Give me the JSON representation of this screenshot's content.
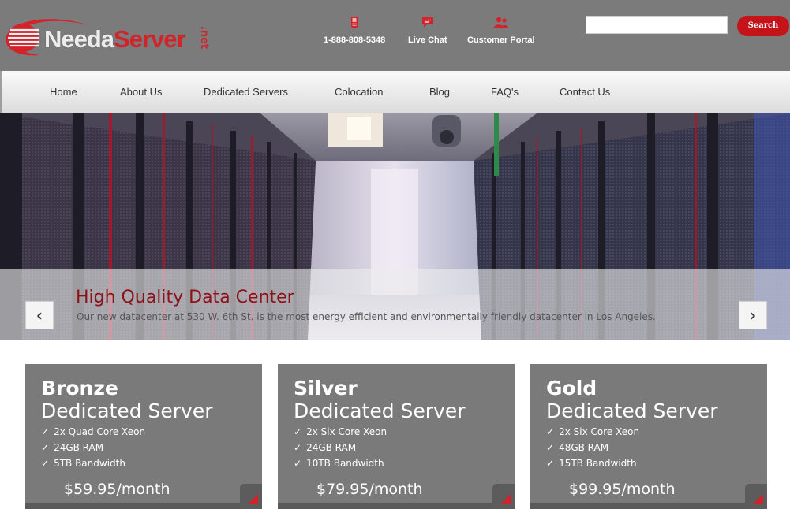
{
  "logo": {
    "part1": "Needa",
    "part2": "Server",
    "tld": ".net"
  },
  "header": {
    "links": [
      {
        "label": "1-888-808-5348",
        "icon": "phone-icon"
      },
      {
        "label": "Live Chat",
        "icon": "chat-bubble-icon"
      },
      {
        "label": "Customer Portal",
        "icon": "users-icon"
      }
    ],
    "search": {
      "value": "",
      "button": "Search"
    }
  },
  "nav": {
    "items": [
      "Home",
      "About Us",
      "Dedicated Servers",
      "Colocation",
      "Blog",
      "FAQ's",
      "Contact Us"
    ]
  },
  "hero": {
    "title": "High Quality Data Center",
    "text": "Our new datacenter at 530 W. 6th St. is the most energy efficient and environmentally friendly datacenter in Los Angeles.",
    "prev": "‹",
    "next": "›"
  },
  "plans": [
    {
      "tier": "Bronze",
      "subtitle": "Dedicated Server",
      "features": [
        "2x Quad Core Xeon",
        "24GB RAM",
        "5TB Bandwidth"
      ],
      "price": "$59.95/month"
    },
    {
      "tier": "Silver",
      "subtitle": "Dedicated Server",
      "features": [
        "2x Six Core Xeon",
        "24GB RAM",
        "10TB Bandwidth"
      ],
      "price": "$79.95/month"
    },
    {
      "tier": "Gold",
      "subtitle": "Dedicated Server",
      "features": [
        "2x Six Core Xeon",
        "48GB RAM",
        "15TB Bandwidth"
      ],
      "price": "$99.95/month"
    }
  ],
  "colors": {
    "brand_red": "#d2232a",
    "header_gray": "#7b7b7b",
    "card_gray": "#7a7a7a",
    "caption_title": "#8a1218"
  },
  "check_glyph": "✓"
}
